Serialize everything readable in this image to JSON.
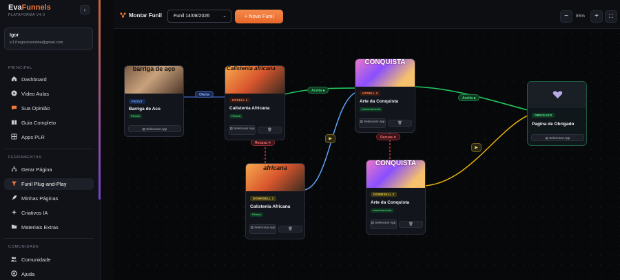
{
  "brand": {
    "name_a": "Eva",
    "name_b": "Funnels",
    "platform": "PLATAFORMA V4.0"
  },
  "sidebar": {
    "collapse_icon": "chevron-left-icon",
    "user": {
      "name": "Igor",
      "email": "ic17negociosonline@gmail.com"
    },
    "sections": {
      "principal": "PRINCIPAL",
      "ferramentas": "FERRAMENTAS",
      "comunidade": "COMUNIDADE"
    },
    "principal_items": [
      {
        "label": "Dashboard",
        "icon": "home-icon"
      },
      {
        "label": "Vídeo Aulas",
        "icon": "play-icon"
      },
      {
        "label": "Sua Opinião",
        "icon": "chat-icon"
      },
      {
        "label": "Guia Completo",
        "icon": "book-icon"
      },
      {
        "label": "Apps PLR",
        "icon": "grid-icon"
      }
    ],
    "ferramentas_items": [
      {
        "label": "Gerar Página",
        "icon": "sitemap-icon"
      },
      {
        "label": "Funil Plug-and-Play",
        "icon": "funnel-icon",
        "active": true
      },
      {
        "label": "Minhas Páginas",
        "icon": "rocket-icon"
      },
      {
        "label": "Criativos IA",
        "icon": "sparkle-icon"
      },
      {
        "label": "Materiais Extras",
        "icon": "folder-icon"
      }
    ],
    "comunidade_items": [
      {
        "label": "Comunidade",
        "icon": "users-icon"
      },
      {
        "label": "Ajuda",
        "icon": "help-icon"
      }
    ]
  },
  "topbar": {
    "title": "Montar Funil",
    "funnel_select": "Funil 14/08/2026",
    "new_button": "+ Novo Funil",
    "zoom_out": "−",
    "zoom_value": "85%",
    "zoom_in": "+",
    "fit_icon": "fit-view-icon"
  },
  "colors": {
    "accent": "#f47b3c",
    "offer_edge": "#3b5aa8",
    "accept_edge": "#22c55e",
    "decline_edge": "#e0414a",
    "blue_edge": "#60a5fa",
    "yellow_edge": "#eab308"
  },
  "nodes": {
    "front": {
      "tag": "FRONT",
      "title": "Barriga de Aco",
      "category": "Fitness",
      "app_button": "Selecionar App",
      "banner_text": "barriga de aço"
    },
    "upsell1": {
      "tag": "UPSELL 1",
      "title": "Calistenia Africana",
      "category": "Fitness",
      "app_button": "Selecionar App",
      "delete_icon": "trash-icon",
      "banner_text": "Calistenia africana"
    },
    "upsell2": {
      "tag": "UPSELL 2",
      "title": "Arte da Conquista",
      "category": "relacionamento",
      "app_button": "Selecionar App",
      "delete_icon": "trash-icon",
      "banner_text": "CONQUISTA"
    },
    "downsell1": {
      "tag": "DOWNSELL 1",
      "title": "Calistenia Africana",
      "category": "Fitness",
      "app_button": "Selecionar App",
      "delete_icon": "trash-icon",
      "banner_text": "africana"
    },
    "downsell2": {
      "tag": "DOWNSELL 2",
      "title": "Arte da Conquista",
      "category": "relacionamento",
      "app_button": "Selecionar App",
      "delete_icon": "trash-icon",
      "banner_text": "CONQUISTA"
    },
    "obrigado": {
      "tag": "OBRIGADO",
      "title": "Pagina de Obrigado",
      "app_button": "Selecionar App",
      "icon": "heart-icon"
    }
  },
  "edges": {
    "offer": "Oferta",
    "accept1": "Aceita ■",
    "accept2": "Aceita ■",
    "decline1": "Recusa ✕",
    "decline2": "Recusa ✕",
    "play_icon": "▶"
  }
}
